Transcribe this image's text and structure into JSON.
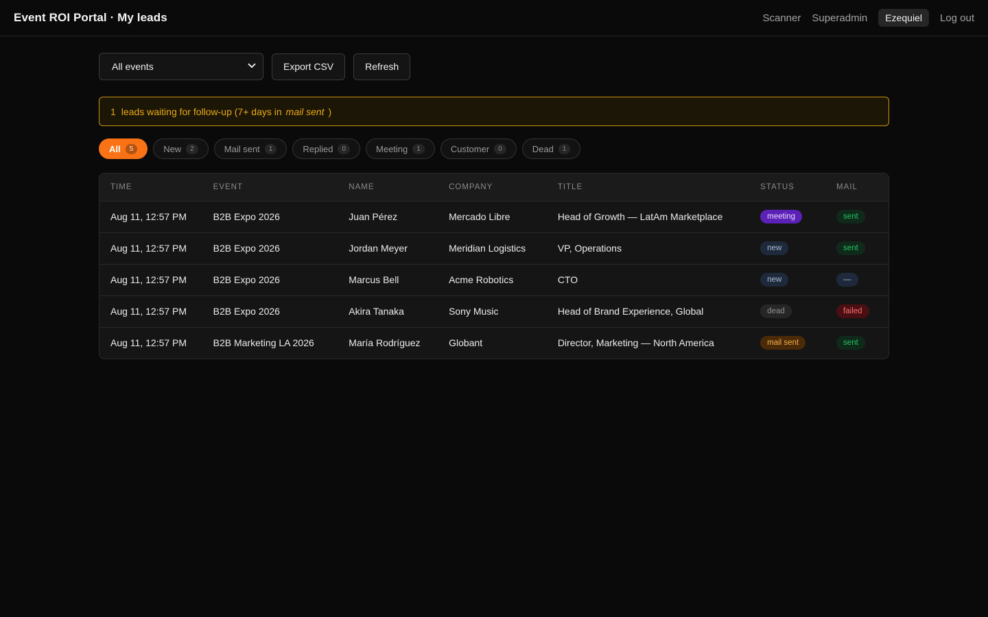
{
  "header": {
    "title": "Event ROI Portal · My leads",
    "nav": {
      "scanner": "Scanner",
      "superadmin": "Superadmin",
      "user": "Ezequiel",
      "logout": "Log out"
    }
  },
  "toolbar": {
    "event_select": "All events",
    "export_label": "Export CSV",
    "refresh_label": "Refresh"
  },
  "banner": {
    "count": "1",
    "text": "leads waiting for follow-up (7+ days in",
    "status": "mail sent",
    "close": ")"
  },
  "filters": [
    {
      "label": "All",
      "count": "5"
    },
    {
      "label": "New",
      "count": "2"
    },
    {
      "label": "Mail sent",
      "count": "1"
    },
    {
      "label": "Replied",
      "count": "0"
    },
    {
      "label": "Meeting",
      "count": "1"
    },
    {
      "label": "Customer",
      "count": "0"
    },
    {
      "label": "Dead",
      "count": "1"
    }
  ],
  "table": {
    "headers": {
      "time": "TIME",
      "event": "EVENT",
      "name": "NAME",
      "company": "COMPANY",
      "title": "TITLE",
      "status": "STATUS",
      "mail": "MAIL"
    },
    "rows": [
      {
        "time": "Aug 11, 12:57 PM",
        "event": "B2B Expo 2026",
        "name": "Juan Pérez",
        "company": "Mercado Libre",
        "title": "Head of Growth — LatAm Marketplace",
        "status": "meeting",
        "mail": "sent"
      },
      {
        "time": "Aug 11, 12:57 PM",
        "event": "B2B Expo 2026",
        "name": "Jordan Meyer",
        "company": "Meridian Logistics",
        "title": "VP, Operations",
        "status": "new",
        "mail": "sent"
      },
      {
        "time": "Aug 11, 12:57 PM",
        "event": "B2B Expo 2026",
        "name": "Marcus Bell",
        "company": "Acme Robotics",
        "title": "CTO",
        "status": "new",
        "mail": "—"
      },
      {
        "time": "Aug 11, 12:57 PM",
        "event": "B2B Expo 2026",
        "name": "Akira Tanaka",
        "company": "Sony Music",
        "title": "Head of Brand Experience, Global",
        "status": "dead",
        "mail": "failed"
      },
      {
        "time": "Aug 11, 12:57 PM",
        "event": "B2B Marketing LA 2026",
        "name": "María Rodríguez",
        "company": "Globant",
        "title": "Director, Marketing — North America",
        "status": "mail sent",
        "mail": "sent"
      }
    ]
  },
  "colors": {
    "accent": "#f97316",
    "warning": "#e8a917",
    "meeting": "#5b21b6",
    "sent": "#22c55e",
    "failed": "#f87171"
  }
}
